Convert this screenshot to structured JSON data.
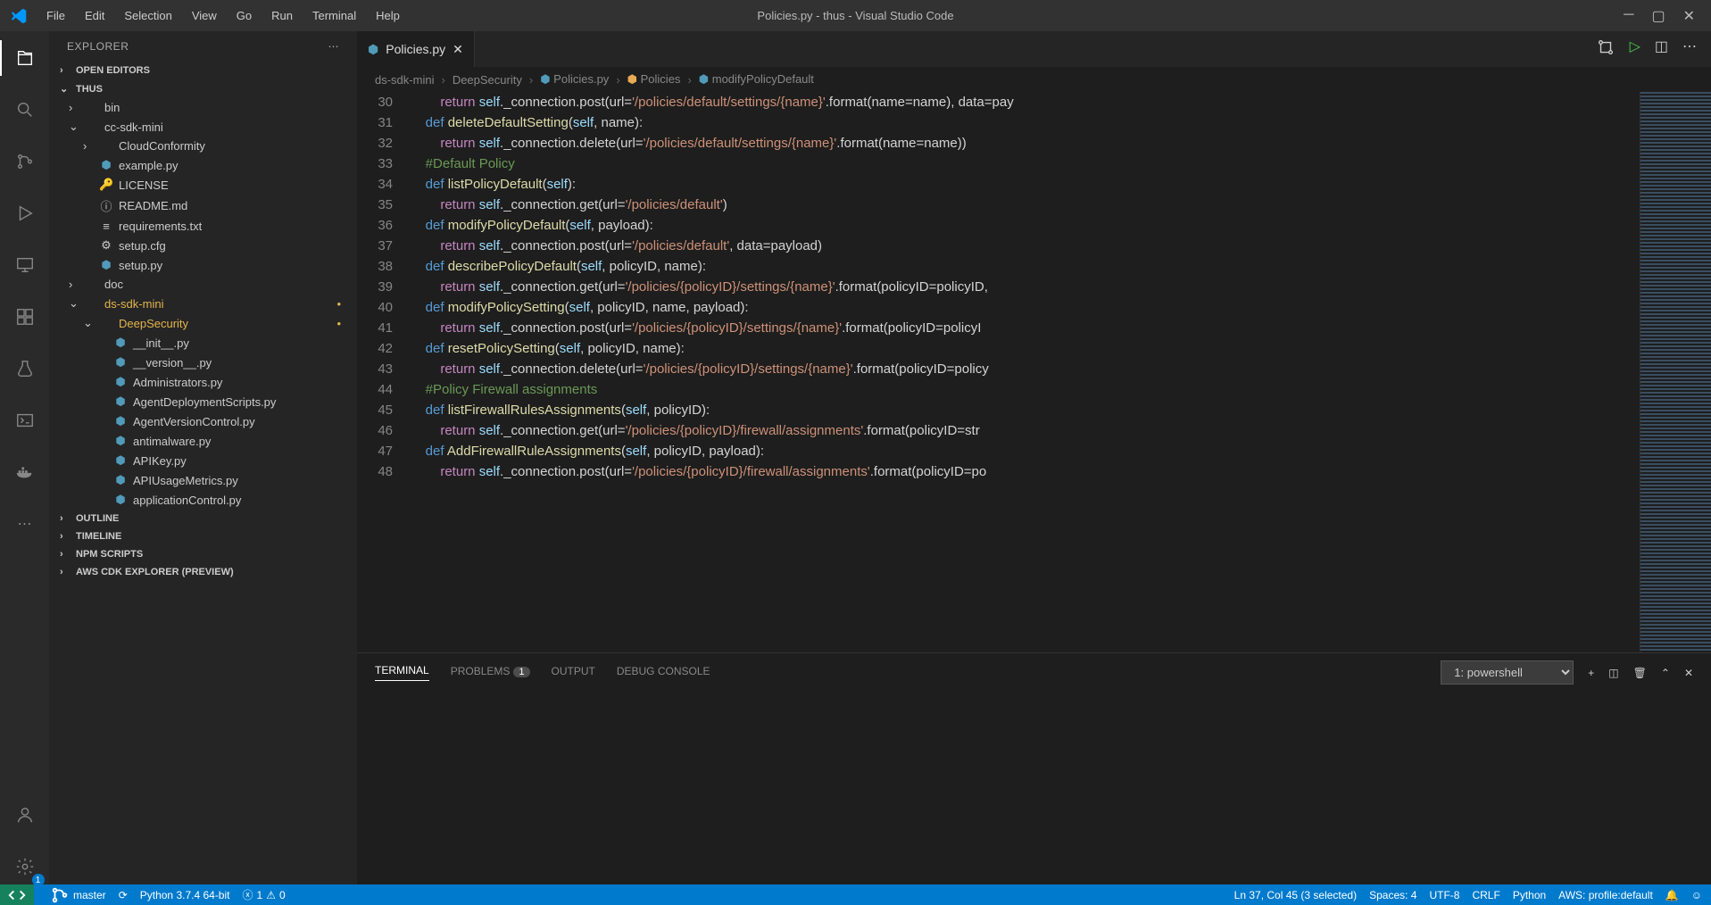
{
  "title": "Policies.py - thus - Visual Studio Code",
  "menu": [
    "File",
    "Edit",
    "Selection",
    "View",
    "Go",
    "Run",
    "Terminal",
    "Help"
  ],
  "sidebar": {
    "title": "EXPLORER",
    "sections": {
      "open_editors": "OPEN EDITORS",
      "workspace": "THUS",
      "outline": "OUTLINE",
      "timeline": "TIMELINE",
      "npm": "NPM SCRIPTS",
      "cdk": "AWS CDK EXPLORER (PREVIEW)"
    },
    "tree": [
      {
        "label": "bin",
        "type": "folder",
        "depth": 1,
        "collapsed": true
      },
      {
        "label": "cc-sdk-mini",
        "type": "folder",
        "depth": 1,
        "collapsed": false
      },
      {
        "label": "CloudConformity",
        "type": "folder",
        "depth": 2,
        "collapsed": true
      },
      {
        "label": "example.py",
        "type": "python",
        "depth": 2
      },
      {
        "label": "LICENSE",
        "type": "license",
        "depth": 2
      },
      {
        "label": "README.md",
        "type": "md",
        "depth": 2
      },
      {
        "label": "requirements.txt",
        "type": "txt",
        "depth": 2
      },
      {
        "label": "setup.cfg",
        "type": "cfg",
        "depth": 2
      },
      {
        "label": "setup.py",
        "type": "python",
        "depth": 2
      },
      {
        "label": "doc",
        "type": "folder",
        "depth": 1,
        "collapsed": true
      },
      {
        "label": "ds-sdk-mini",
        "type": "folder",
        "depth": 1,
        "collapsed": false,
        "modified": true
      },
      {
        "label": "DeepSecurity",
        "type": "folder",
        "depth": 2,
        "collapsed": false,
        "modified": true
      },
      {
        "label": "__init__.py",
        "type": "python",
        "depth": 3
      },
      {
        "label": "__version__.py",
        "type": "python",
        "depth": 3
      },
      {
        "label": "Administrators.py",
        "type": "python",
        "depth": 3
      },
      {
        "label": "AgentDeploymentScripts.py",
        "type": "python",
        "depth": 3
      },
      {
        "label": "AgentVersionControl.py",
        "type": "python",
        "depth": 3
      },
      {
        "label": "antimalware.py",
        "type": "python",
        "depth": 3
      },
      {
        "label": "APIKey.py",
        "type": "python",
        "depth": 3
      },
      {
        "label": "APIUsageMetrics.py",
        "type": "python",
        "depth": 3
      },
      {
        "label": "applicationControl.py",
        "type": "python",
        "depth": 3
      }
    ]
  },
  "tab": {
    "label": "Policies.py"
  },
  "breadcrumbs": [
    "ds-sdk-mini",
    "DeepSecurity",
    "Policies.py",
    "Policies",
    "modifyPolicyDefault"
  ],
  "code_lines": [
    {
      "n": 30,
      "html": "        <span class='kw'>return</span> <span class='var'>self</span>._connection.post(url=<span class='str'>'/policies/default/settings/{name}'</span>.format(name=name), data=pay"
    },
    {
      "n": 31,
      "html": "    <span class='def'>def</span> <span class='fn'>deleteDefaultSetting</span>(<span class='var'>self</span>, name):"
    },
    {
      "n": 32,
      "html": "        <span class='kw'>return</span> <span class='var'>self</span>._connection.delete(url=<span class='str'>'/policies/default/settings/{name}'</span>.format(name=name))"
    },
    {
      "n": 33,
      "html": "    <span class='cmt'>#Default Policy</span>"
    },
    {
      "n": 34,
      "html": "    <span class='def'>def</span> <span class='fn'>listPolicyDefault</span>(<span class='var'>self</span>):"
    },
    {
      "n": 35,
      "html": "        <span class='kw'>return</span> <span class='var'>self</span>._connection.get(url=<span class='str'>'/policies/default'</span>)"
    },
    {
      "n": 36,
      "html": "    <span class='def'>def</span> <span class='fn'>modifyPolicyDefault</span>(<span class='var'>self</span>, payload):"
    },
    {
      "n": 37,
      "html": "        <span class='kw'>return</span> <span class='var'>self</span>._connection.post(url=<span class='str'>'/policies/default'</span>, data=payload)"
    },
    {
      "n": 38,
      "html": "    <span class='def'>def</span> <span class='fn'>describePolicyDefault</span>(<span class='var'>self</span>, policyID, name):"
    },
    {
      "n": 39,
      "html": "        <span class='kw'>return</span> <span class='var'>self</span>._connection.get(url=<span class='str'>'/policies/{policyID}/settings/{name}'</span>.format(policyID=policyID,"
    },
    {
      "n": 40,
      "html": "    <span class='def'>def</span> <span class='fn'>modifyPolicySetting</span>(<span class='var'>self</span>, policyID, name, payload):"
    },
    {
      "n": 41,
      "html": "        <span class='kw'>return</span> <span class='var'>self</span>._connection.post(url=<span class='str'>'/policies/{policyID}/settings/{name}'</span>.format(policyID=policyI"
    },
    {
      "n": 42,
      "html": "    <span class='def'>def</span> <span class='fn'>resetPolicySetting</span>(<span class='var'>self</span>, policyID, name):"
    },
    {
      "n": 43,
      "html": "        <span class='kw'>return</span> <span class='var'>self</span>._connection.delete(url=<span class='str'>'/policies/{policyID}/settings/{name}'</span>.format(policyID=policy"
    },
    {
      "n": 44,
      "html": "    <span class='cmt'>#Policy Firewall assignments</span>"
    },
    {
      "n": 45,
      "html": "    <span class='def'>def</span> <span class='fn'>listFirewallRulesAssignments</span>(<span class='var'>self</span>, policyID):"
    },
    {
      "n": 46,
      "html": "        <span class='kw'>return</span> <span class='var'>self</span>._connection.get(url=<span class='str'>'/policies/{policyID}/firewall/assignments'</span>.format(policyID=str"
    },
    {
      "n": 47,
      "html": "    <span class='def'>def</span> <span class='fn'>AddFirewallRuleAssignments</span>(<span class='var'>self</span>, policyID, payload):"
    },
    {
      "n": 48,
      "html": "        <span class='kw'>return</span> <span class='var'>self</span>._connection.post(url=<span class='str'>'/policies/{policyID}/firewall/assignments'</span>.format(policyID=po"
    }
  ],
  "panel": {
    "tabs": {
      "terminal": "TERMINAL",
      "problems": "PROBLEMS",
      "problems_count": "1",
      "output": "OUTPUT",
      "debug": "DEBUG CONSOLE"
    },
    "shell": "1: powershell"
  },
  "statusbar": {
    "branch": "master",
    "python": "Python 3.7.4 64-bit",
    "errors": "1",
    "warnings": "0",
    "cursor": "Ln 37, Col 45 (3 selected)",
    "spaces": "Spaces: 4",
    "encoding": "UTF-8",
    "eol": "CRLF",
    "lang": "Python",
    "aws": "AWS: profile:default"
  },
  "gear_badge": "1"
}
